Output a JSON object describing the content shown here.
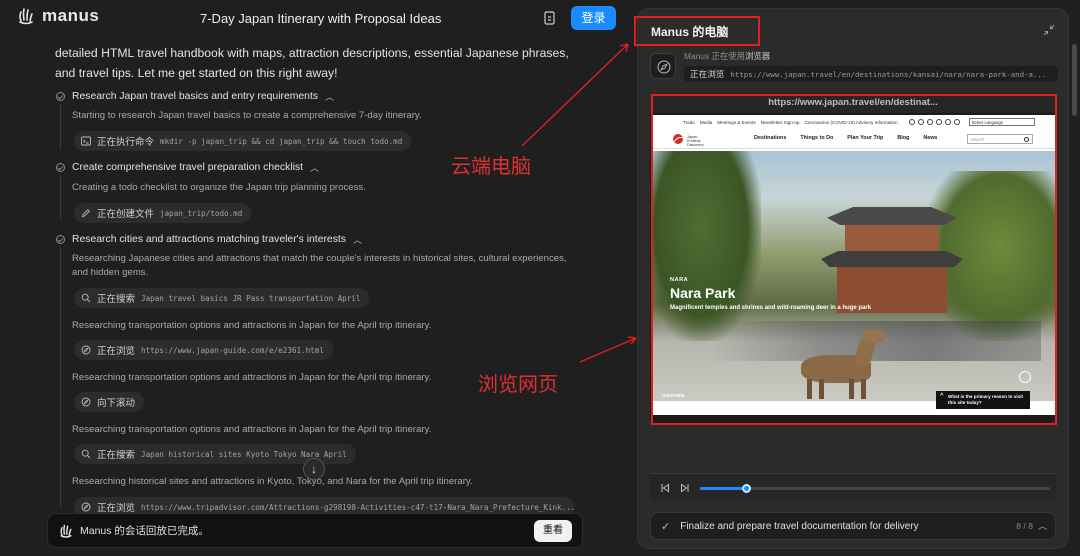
{
  "app": {
    "logo_text": "manus",
    "title": "7-Day Japan Itinerary with Proposal Ideas",
    "login_label": "登录"
  },
  "intro": "detailed HTML travel handbook with maps, attraction descriptions, essential Japanese phrases, and travel tips. Let me get started on this right away!",
  "steps": [
    {
      "label": "Research Japan travel basics and entry requirements",
      "desc": "Starting to research Japan travel basics to create a comprehensive 7-day itinerary.",
      "action": {
        "label": "正在执行命令",
        "detail": "mkdir -p japan_trip && cd japan_trip && touch todo.md",
        "icon": "terminal-icon"
      }
    },
    {
      "label": "Create comprehensive travel preparation checklist",
      "desc": "Creating a todo checklist to organize the Japan trip planning process.",
      "action": {
        "label": "正在创建文件",
        "detail": "japan_trip/todo.md",
        "icon": "edit-icon"
      }
    },
    {
      "label": "Research cities and attractions matching traveler's interests",
      "desc": "Researching Japanese cities and attractions that match the couple's interests in historical sites, cultural experiences, and hidden gems.",
      "action": {
        "label": "正在搜索",
        "detail": "Japan travel basics JR Pass transportation April",
        "icon": "search-icon"
      }
    }
  ],
  "log": [
    {
      "text": "Researching transportation options and attractions in Japan for the April trip itinerary.",
      "action": {
        "label": "正在浏览",
        "detail": "https://www.japan-guide.com/e/e2361.html",
        "icon": "compass-icon"
      }
    },
    {
      "text": "Researching transportation options and attractions in Japan for the April trip itinerary.",
      "action": {
        "label": "向下滚动",
        "detail": "",
        "icon": "compass-icon"
      }
    },
    {
      "text": "Researching transportation options and attractions in Japan for the April trip itinerary.",
      "action": {
        "label": "正在搜索",
        "detail": "Japan historical sites Kyoto Tokyo Nara April",
        "icon": "search-icon"
      }
    },
    {
      "text": "Researching historical sites and attractions in Kyoto, Tokyo, and Nara for the April trip itinerary.",
      "action": {
        "label": "正在浏览",
        "detail": "https://www.tripadvisor.com/Attractions-g298198-Activities-c47-t17-Nara_Nara_Prefecture_Kink...",
        "icon": "compass-icon"
      }
    }
  ],
  "bottom": {
    "message": "Manus 的会话回放已完成。",
    "replay_label": "重看"
  },
  "computer": {
    "title": "Manus 的电脑",
    "agent_prefix": "Manus 正在使用",
    "agent_tool": "浏览器",
    "status_label": "正在浏览",
    "status_url": "https://www.japan.travel/en/destinations/kansai/nara/nara-park-and-a...",
    "address_bar": "https://www.japan.travel/en/destinat..."
  },
  "website": {
    "top_links": [
      "Trade",
      "Media",
      "Meetings & Events",
      "Newsletter Sign-up",
      "Coronavirus (COVID-19) Advisory Information"
    ],
    "language": "Select Language",
    "logo_text": "Japan Endless Discovery",
    "nav": [
      "Destinations",
      "Things to Do",
      "Plan Your Trip",
      "Blog",
      "News"
    ],
    "search_placeholder": "Search",
    "hero_kicker": "NARA",
    "hero_title": "Nara Park",
    "hero_desc": "Magnificent temples and shrines and wild-roaming deer in a huge park",
    "overview": "OVERVIEW",
    "survey": "What is the primary reason to visit this site today?"
  },
  "player": {
    "progress": 0.13
  },
  "task": {
    "label": "Finalize and prepare travel documentation for delivery",
    "count": "8 / 8"
  },
  "annotations": {
    "cloud_pc": "云端电脑",
    "browse_page": "浏览网页"
  },
  "colors": {
    "accent": "#1a8cff",
    "annotation": "#e02020"
  }
}
